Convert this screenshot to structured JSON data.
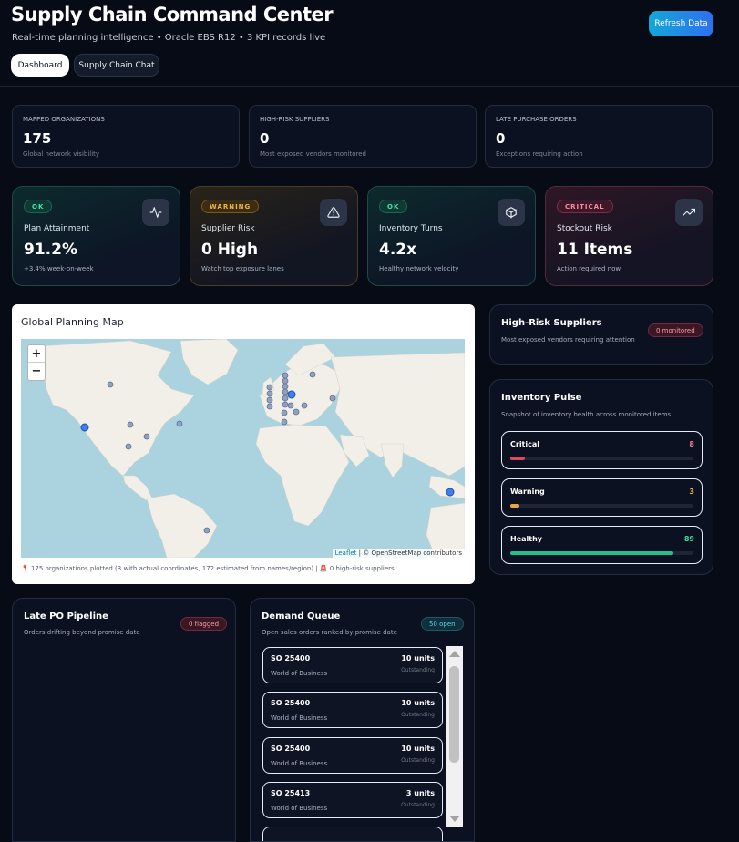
{
  "header": {
    "title": "Supply Chain Command Center",
    "subtitle": "Real-time planning intelligence • Oracle EBS R12 • 3 KPI records live",
    "refresh_label": "Refresh Data",
    "tabs": [
      {
        "label": "Dashboard",
        "active": true
      },
      {
        "label": "Supply Chain Chat",
        "active": false
      }
    ]
  },
  "stats": [
    {
      "label": "MAPPED ORGANIZATIONS",
      "value": "175",
      "note": "Global network visibility"
    },
    {
      "label": "HIGH-RISK SUPPLIERS",
      "value": "0",
      "note": "Most exposed vendors monitored"
    },
    {
      "label": "LATE PURCHASE ORDERS",
      "value": "0",
      "note": "Exceptions requiring action"
    }
  ],
  "kpis": [
    {
      "badge": "OK",
      "label": "Plan Attainment",
      "value": "91.2%",
      "note": "+3.4% week-on-week",
      "icon": "activity-icon"
    },
    {
      "badge": "WARNING",
      "label": "Supplier Risk",
      "value": "0 High",
      "note": "Watch top exposure lanes",
      "icon": "alert-triangle-icon"
    },
    {
      "badge": "OK",
      "label": "Inventory Turns",
      "value": "4.2x",
      "note": "Healthy network velocity",
      "icon": "package-icon"
    },
    {
      "badge": "CRITICAL",
      "label": "Stockout Risk",
      "value": "11 Items",
      "note": "Action required now",
      "icon": "trending-up-icon"
    }
  ],
  "map": {
    "title": "Global Planning Map",
    "zoom_in": "+",
    "zoom_out": "−",
    "attribution_leaflet": "Leaflet",
    "attribution_rest": " | © OpenStreetMap contributors",
    "footer": "📍 175 organizations plotted (3 with actual coordinates, 172 estimated from names/region) | 🚨 0 high-risk suppliers"
  },
  "high_risk": {
    "title": "High-Risk Suppliers",
    "subtitle": "Most exposed vendors requiring attention",
    "badge": "0 monitored"
  },
  "inventory_pulse": {
    "title": "Inventory Pulse",
    "subtitle": "Snapshot of inventory health across monitored items",
    "rows": [
      {
        "label": "Critical",
        "count": "8",
        "fraction": 0.08,
        "color": "#e0485e"
      },
      {
        "label": "Warning",
        "count": "3",
        "fraction": 0.05,
        "color": "#f0a53a"
      },
      {
        "label": "Healthy",
        "count": "89",
        "fraction": 0.89,
        "color": "#22c08f"
      }
    ]
  },
  "late_po": {
    "title": "Late PO Pipeline",
    "subtitle": "Orders drifting beyond promise date",
    "badge": "0 flagged"
  },
  "demand_queue": {
    "title": "Demand Queue",
    "subtitle": "Open sales orders ranked by promise date",
    "badge": "50 open",
    "orders": [
      {
        "id": "SO 25400",
        "customer": "World of Business",
        "units": "10 units",
        "status": "Outstanding"
      },
      {
        "id": "SO 25400",
        "customer": "World of Business",
        "units": "10 units",
        "status": "Outstanding"
      },
      {
        "id": "SO 25400",
        "customer": "World of Business",
        "units": "10 units",
        "status": "Outstanding"
      },
      {
        "id": "SO 25413",
        "customer": "World of Business",
        "units": "3 units",
        "status": "Outstanding"
      }
    ]
  }
}
